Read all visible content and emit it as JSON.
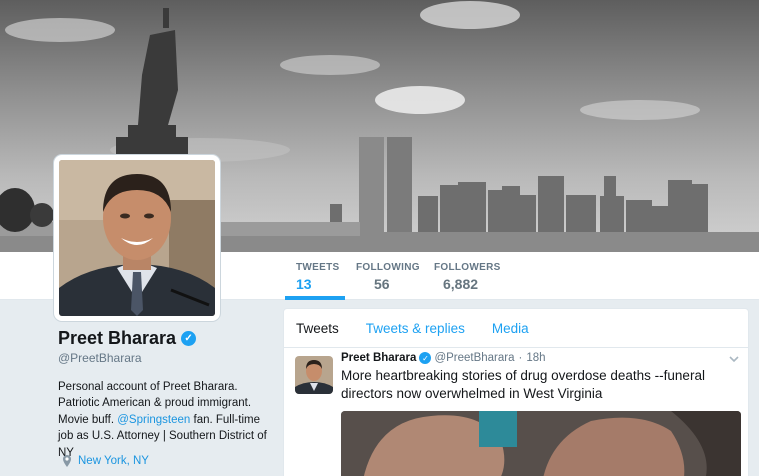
{
  "profile": {
    "name": "Preet Bharara",
    "handle": "@PreetBharara",
    "bio_parts": [
      "Personal account of Preet Bharara. Patriotic American & proud immigrant. Movie buff. ",
      "@Springsteen",
      " fan. Full-time job as U.S. Attorney | Southern District of NY"
    ],
    "location": "New York, NY"
  },
  "stats": [
    {
      "label": "TWEETS",
      "value": "13"
    },
    {
      "label": "FOLLOWING",
      "value": "56"
    },
    {
      "label": "FOLLOWERS",
      "value": "6,882"
    }
  ],
  "tabs": [
    "Tweets",
    "Tweets & replies",
    "Media"
  ],
  "tweet": {
    "name": "Preet Bharara",
    "handle": "@PreetBharara",
    "separator": "·",
    "time": "18h",
    "text": "More heartbreaking stories of drug overdose deaths --funeral directors now overwhelmed in West Virginia"
  },
  "colors": {
    "accent": "#1da1f2",
    "link": "#1b95e0",
    "background": "#e6ecf0"
  },
  "icons": {
    "verified": "verified-badge-icon",
    "location": "location-pin-icon",
    "caret": "chevron-down-icon"
  }
}
